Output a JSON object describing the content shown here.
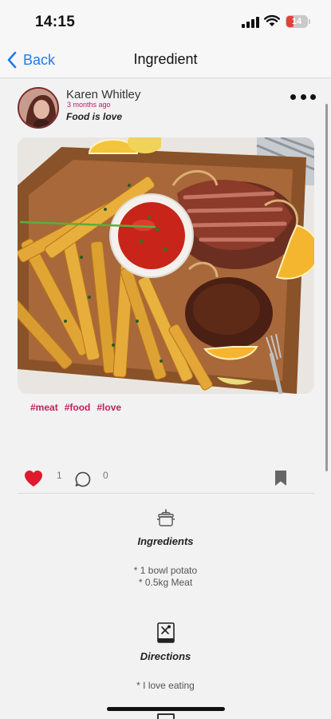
{
  "status_bar": {
    "time": "14:15",
    "battery": "14"
  },
  "nav": {
    "back_label": "Back",
    "title": "Ingredient"
  },
  "post": {
    "author": "Karen Whitley",
    "time_ago": "3 months ago",
    "caption": "Food is love",
    "tags": [
      "#meat",
      "#food",
      "#love"
    ],
    "likes": "1",
    "comments": "0",
    "liked": true
  },
  "ingredients": {
    "title": "Ingredients",
    "items": [
      "* 1 bowl potato",
      "* 0.5kg Meat"
    ]
  },
  "directions": {
    "title": "Directions",
    "items": [
      "* I love eating"
    ]
  },
  "colors": {
    "accent": "#1f7bf2",
    "like": "#e0192c",
    "tag": "#c0205f"
  }
}
